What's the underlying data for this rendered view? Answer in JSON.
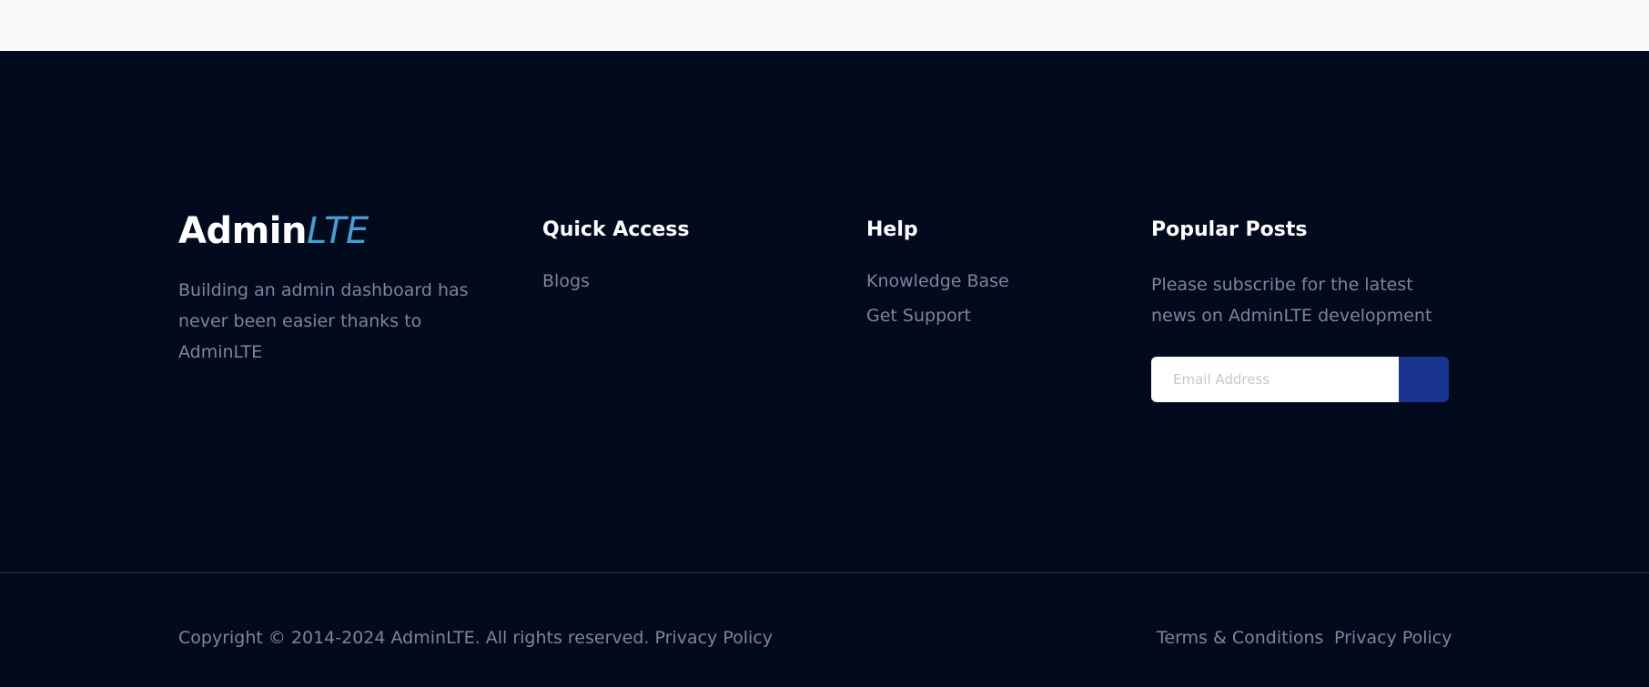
{
  "brand": {
    "name_bold": "Admin",
    "name_italic": "LTE",
    "accent_color": "#4a9ccf",
    "description": "Building an admin dashboard has never been easier thanks to AdminLTE"
  },
  "quick_access": {
    "title": "Quick Access",
    "links": [
      "Blogs"
    ]
  },
  "help": {
    "title": "Help",
    "links": [
      "Knowledge Base",
      "Get Support"
    ]
  },
  "popular_posts": {
    "title": "Popular Posts",
    "text": "Please subscribe for the latest news on AdminLTE development",
    "email_placeholder": "Email Address",
    "button_color": "#1a3590"
  },
  "bottom": {
    "copyright": "Copyright © 2014-2024 AdminLTE. All rights reserved.",
    "copyright_link": "Privacy Policy",
    "links": [
      "Terms & Conditions",
      "Privacy Policy"
    ]
  },
  "colors": {
    "footer_bg": "#020a1e",
    "topbar_bg": "#faf9f7",
    "muted_text": "#7e859a"
  }
}
